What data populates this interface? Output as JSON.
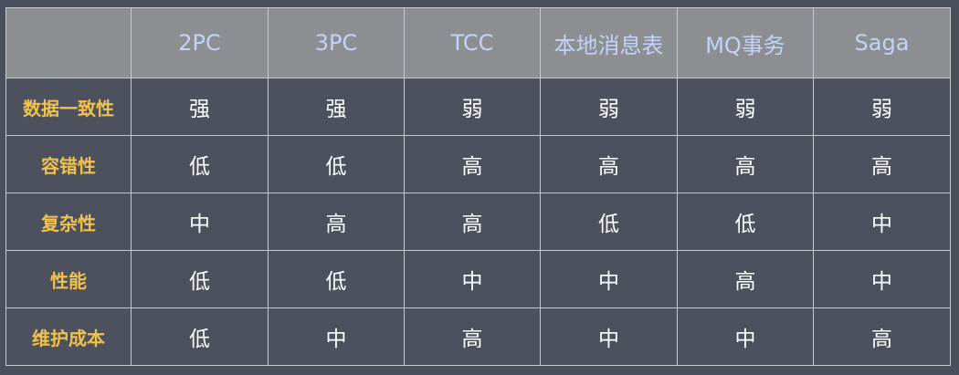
{
  "table": {
    "columns": [
      "2PC",
      "3PC",
      "TCC",
      "本地消息表",
      "MQ事务",
      "Saga"
    ],
    "rows": [
      {
        "label": "数据一致性",
        "values": [
          "强",
          "强",
          "弱",
          "弱",
          "弱",
          "弱"
        ]
      },
      {
        "label": "容错性",
        "values": [
          "低",
          "低",
          "高",
          "高",
          "高",
          "高"
        ]
      },
      {
        "label": "复杂性",
        "values": [
          "中",
          "高",
          "高",
          "低",
          "低",
          "中"
        ]
      },
      {
        "label": "性能",
        "values": [
          "低",
          "低",
          "中",
          "中",
          "高",
          "中"
        ]
      },
      {
        "label": "维护成本",
        "values": [
          "低",
          "中",
          "高",
          "中",
          "中",
          "高"
        ]
      }
    ]
  },
  "colors": {
    "background": "#4b4e5c",
    "header_fill": "#8c8e91",
    "header_text": "#c3d2f7",
    "row_label_text": "#f0c14c",
    "value_text": "#ffffff",
    "grid_line": "#c9cacf"
  }
}
